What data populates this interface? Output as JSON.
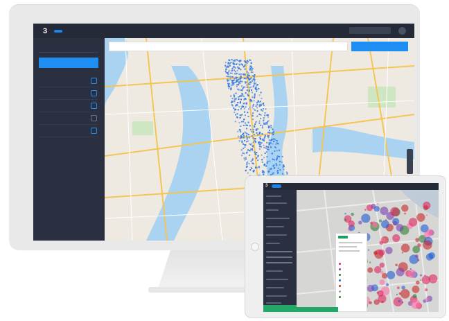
{
  "app": {
    "logo": "3",
    "nav_active": "",
    "nav_items": [
      "",
      "",
      "",
      ""
    ],
    "top_button": "",
    "avatar": ""
  },
  "sidebar": {
    "select_value": "",
    "primary_button": "",
    "rows": [
      "",
      "",
      "",
      "",
      ""
    ],
    "footer_link": ""
  },
  "map": {
    "search_placeholder": "",
    "action_button": ""
  },
  "tablet": {
    "logo": "3"
  },
  "colors": {
    "accent": "#1e8ef2",
    "topbar": "#242a38",
    "sidebar": "#2a3040",
    "green": "#23a867",
    "map_bg": "#eeeae1",
    "water": "#a9d3f0",
    "point": "#2d74e4"
  },
  "icons": {
    "row_icon": "square-outline-icon",
    "search": "search-icon"
  }
}
